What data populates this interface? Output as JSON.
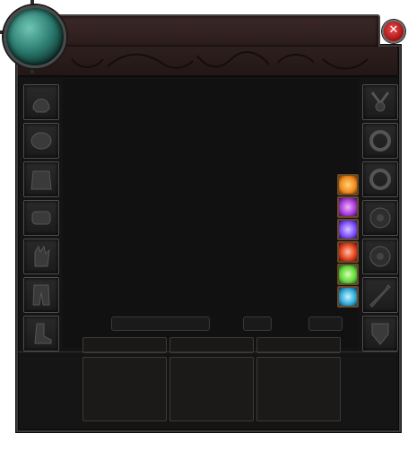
{
  "window": {
    "title": ""
  },
  "left_slots": [
    "helmet-icon",
    "shoulders-icon",
    "chest-armor-icon",
    "bracers-icon",
    "gloves-icon",
    "pants-icon",
    "boots-icon"
  ],
  "right_slots": [
    "amulet-icon",
    "ring-icon",
    "ring-icon",
    "gem-socket-icon",
    "gem-socket-icon",
    "weapon-icon",
    "offhand-icon"
  ],
  "buffs": [
    {
      "name": "fire-buff-icon",
      "color": "#f08a1a"
    },
    {
      "name": "arcane-buff-icon",
      "color": "#a33ad6"
    },
    {
      "name": "energy-buff-icon",
      "color": "#7a4cff"
    },
    {
      "name": "flame-buff-icon",
      "color": "#e2401e"
    },
    {
      "name": "skull-buff-icon",
      "color": "#5fd63a"
    },
    {
      "name": "frost-buff-icon",
      "color": "#2fa8d8"
    }
  ],
  "colors": {
    "frame": "#151414",
    "title_bar": "#2b1d1c",
    "close": "#c62828",
    "orb": "#2c7d71"
  }
}
